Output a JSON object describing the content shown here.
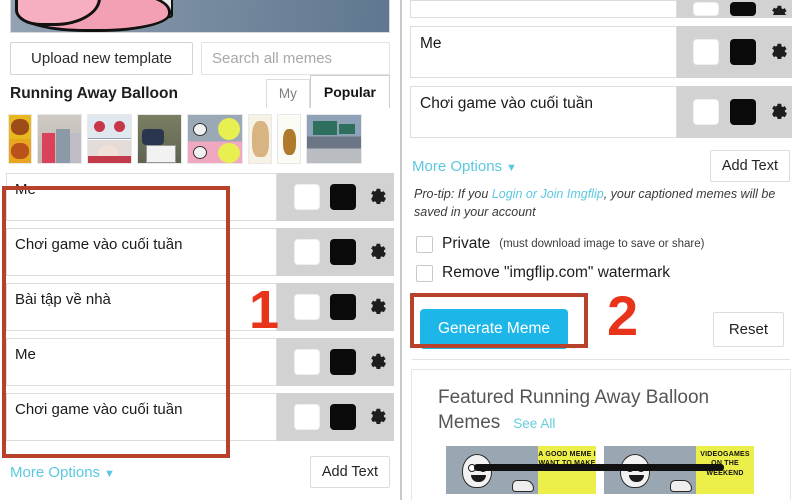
{
  "left_panel": {
    "banner": {
      "alt": "running-away-balloon-template-preview"
    },
    "upload_button": "Upload new template",
    "search_placeholder": "Search all memes",
    "template_title": "Running Away Balloon",
    "tabs": [
      {
        "label": "My",
        "active": false
      },
      {
        "label": "Popular",
        "active": true
      }
    ],
    "thumbnails": [
      "thumb-bear-yellow",
      "thumb-couple-street",
      "thumb-comic-panels",
      "thumb-car-road",
      "thumb-balloon-two",
      "thumb-body-figure",
      "thumb-dog-small",
      "thumb-highway-sign"
    ],
    "caption_rows": [
      {
        "text": "Me",
        "swatch_outline": "#ffffff",
        "swatch_fill": "#0a0a0a"
      },
      {
        "text": "Chơi game vào cuối tuần",
        "swatch_outline": "#ffffff",
        "swatch_fill": "#0a0a0a"
      },
      {
        "text": "Bài tập về nhà",
        "swatch_outline": "#ffffff",
        "swatch_fill": "#0a0a0a"
      },
      {
        "text": "Me",
        "swatch_outline": "#ffffff",
        "swatch_fill": "#0a0a0a"
      },
      {
        "text": "Chơi game vào cuối tuần",
        "swatch_outline": "#ffffff",
        "swatch_fill": "#0a0a0a"
      }
    ],
    "more_options": "More Options",
    "more_options_caret": "▼",
    "add_text_button": "Add Text"
  },
  "right_panel": {
    "caption_rows": [
      {
        "text": ""
      },
      {
        "text": "Me"
      },
      {
        "text": "Chơi game vào cuối tuần"
      }
    ],
    "more_options": "More Options",
    "more_options_caret": "▼",
    "add_text_button": "Add Text",
    "protip": {
      "prefix": "Pro-tip: If you ",
      "link": "Login or Join Imgflip",
      "suffix": ", your captioned memes will be saved in your account"
    },
    "checkboxes": [
      {
        "label": "Private",
        "note": "(must download image to save or share)",
        "checked": false
      },
      {
        "label": "Remove \"imgflip.com\" watermark",
        "note": "",
        "checked": false
      }
    ],
    "generate_button": "Generate Meme",
    "reset_button": "Reset",
    "featured": {
      "title": "Featured Running Away Balloon Memes",
      "see_all": "See All",
      "cards": [
        {
          "caption": "A GOOD MEME I WANT TO MAKE"
        },
        {
          "caption": "VIDEOGAMES ON THE WEEKEND"
        }
      ]
    }
  },
  "annotations": [
    {
      "number": "1",
      "color": "#e8341a"
    },
    {
      "number": "2",
      "color": "#e8341a"
    }
  ],
  "colors": {
    "accent_cyan": "#1cb7e8",
    "link_cyan": "#5bc8e0",
    "annotation_red": "#b8412c",
    "annotation_number_red": "#e8341a",
    "control_gray": "#d2d2d2"
  }
}
